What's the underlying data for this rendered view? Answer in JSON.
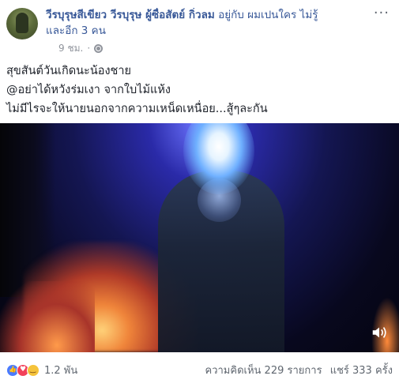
{
  "header": {
    "author": "วีรบุรุษสีเขียว วีรบุรุษ ผู้ซื่อสัตย์ กิ่วลม",
    "with_text": "อยู่กับ ผมเปนใคร ไม่รู้",
    "and_others": "และอีก 3 คน",
    "time": "9 ชม.",
    "separator": "·",
    "menu": "···"
  },
  "post": {
    "lines": [
      "สุขสันต์วันเกิดนะน้องชาย",
      "@อย่าได้หวังร่มเงา จากใบไม้แห้ง",
      "ไม่มีไรจะให้นายนอกจากความเหน็ดเหนื่อย...สู้ๆละกัน"
    ]
  },
  "video": {
    "sound_icon": "speaker-icon"
  },
  "footer": {
    "reaction_count": "1.2 พัน",
    "comments": "ความคิดเห็น 229 รายการ",
    "shares": "แชร์ 333 ครั้ง"
  },
  "colors": {
    "link": "#385898",
    "meta": "#90949c",
    "like": "#4a7bff",
    "love": "#f2415a",
    "haha": "#f5c33b"
  }
}
